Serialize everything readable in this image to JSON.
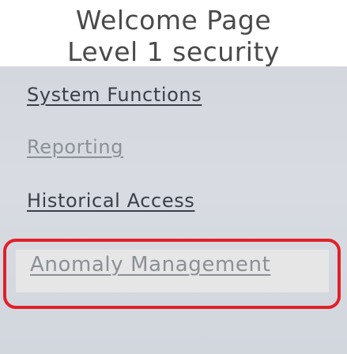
{
  "header": {
    "title_line1": "Welcome Page",
    "title_line2": "Level 1 security"
  },
  "menu": {
    "items": [
      {
        "label": "System Functions"
      },
      {
        "label": "Reporting"
      },
      {
        "label": "Historical Access"
      },
      {
        "label": "Anomaly Management"
      }
    ],
    "selected_index": 3
  },
  "colors": {
    "panel_background": "#d6dae0",
    "selection_border": "#e0212a",
    "link_text": "#3a3f4a",
    "muted_link_text": "#8b9097"
  }
}
